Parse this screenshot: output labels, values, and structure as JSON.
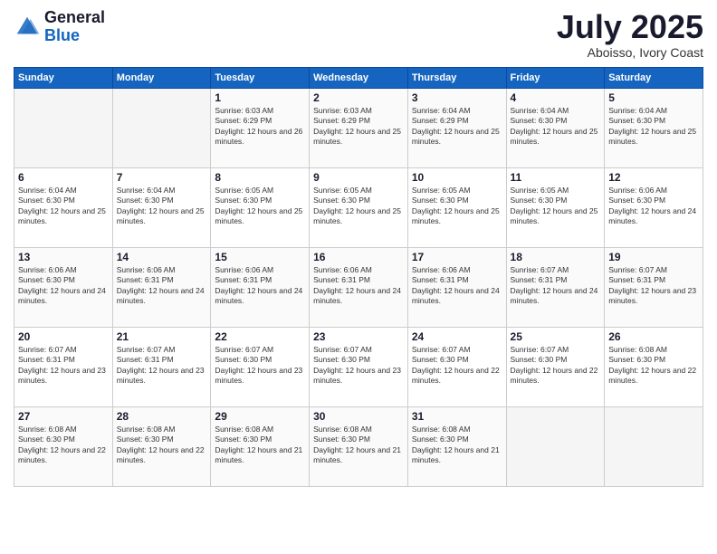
{
  "header": {
    "logo_general": "General",
    "logo_blue": "Blue",
    "month": "July 2025",
    "location": "Aboisso, Ivory Coast"
  },
  "days_of_week": [
    "Sunday",
    "Monday",
    "Tuesday",
    "Wednesday",
    "Thursday",
    "Friday",
    "Saturday"
  ],
  "weeks": [
    [
      {
        "day": "",
        "info": ""
      },
      {
        "day": "",
        "info": ""
      },
      {
        "day": "1",
        "sunrise": "6:03 AM",
        "sunset": "6:29 PM",
        "daylight": "12 hours and 26 minutes."
      },
      {
        "day": "2",
        "sunrise": "6:03 AM",
        "sunset": "6:29 PM",
        "daylight": "12 hours and 25 minutes."
      },
      {
        "day": "3",
        "sunrise": "6:04 AM",
        "sunset": "6:29 PM",
        "daylight": "12 hours and 25 minutes."
      },
      {
        "day": "4",
        "sunrise": "6:04 AM",
        "sunset": "6:30 PM",
        "daylight": "12 hours and 25 minutes."
      },
      {
        "day": "5",
        "sunrise": "6:04 AM",
        "sunset": "6:30 PM",
        "daylight": "12 hours and 25 minutes."
      }
    ],
    [
      {
        "day": "6",
        "sunrise": "6:04 AM",
        "sunset": "6:30 PM",
        "daylight": "12 hours and 25 minutes."
      },
      {
        "day": "7",
        "sunrise": "6:04 AM",
        "sunset": "6:30 PM",
        "daylight": "12 hours and 25 minutes."
      },
      {
        "day": "8",
        "sunrise": "6:05 AM",
        "sunset": "6:30 PM",
        "daylight": "12 hours and 25 minutes."
      },
      {
        "day": "9",
        "sunrise": "6:05 AM",
        "sunset": "6:30 PM",
        "daylight": "12 hours and 25 minutes."
      },
      {
        "day": "10",
        "sunrise": "6:05 AM",
        "sunset": "6:30 PM",
        "daylight": "12 hours and 25 minutes."
      },
      {
        "day": "11",
        "sunrise": "6:05 AM",
        "sunset": "6:30 PM",
        "daylight": "12 hours and 25 minutes."
      },
      {
        "day": "12",
        "sunrise": "6:06 AM",
        "sunset": "6:30 PM",
        "daylight": "12 hours and 24 minutes."
      }
    ],
    [
      {
        "day": "13",
        "sunrise": "6:06 AM",
        "sunset": "6:30 PM",
        "daylight": "12 hours and 24 minutes."
      },
      {
        "day": "14",
        "sunrise": "6:06 AM",
        "sunset": "6:31 PM",
        "daylight": "12 hours and 24 minutes."
      },
      {
        "day": "15",
        "sunrise": "6:06 AM",
        "sunset": "6:31 PM",
        "daylight": "12 hours and 24 minutes."
      },
      {
        "day": "16",
        "sunrise": "6:06 AM",
        "sunset": "6:31 PM",
        "daylight": "12 hours and 24 minutes."
      },
      {
        "day": "17",
        "sunrise": "6:06 AM",
        "sunset": "6:31 PM",
        "daylight": "12 hours and 24 minutes."
      },
      {
        "day": "18",
        "sunrise": "6:07 AM",
        "sunset": "6:31 PM",
        "daylight": "12 hours and 24 minutes."
      },
      {
        "day": "19",
        "sunrise": "6:07 AM",
        "sunset": "6:31 PM",
        "daylight": "12 hours and 23 minutes."
      }
    ],
    [
      {
        "day": "20",
        "sunrise": "6:07 AM",
        "sunset": "6:31 PM",
        "daylight": "12 hours and 23 minutes."
      },
      {
        "day": "21",
        "sunrise": "6:07 AM",
        "sunset": "6:31 PM",
        "daylight": "12 hours and 23 minutes."
      },
      {
        "day": "22",
        "sunrise": "6:07 AM",
        "sunset": "6:30 PM",
        "daylight": "12 hours and 23 minutes."
      },
      {
        "day": "23",
        "sunrise": "6:07 AM",
        "sunset": "6:30 PM",
        "daylight": "12 hours and 23 minutes."
      },
      {
        "day": "24",
        "sunrise": "6:07 AM",
        "sunset": "6:30 PM",
        "daylight": "12 hours and 22 minutes."
      },
      {
        "day": "25",
        "sunrise": "6:07 AM",
        "sunset": "6:30 PM",
        "daylight": "12 hours and 22 minutes."
      },
      {
        "day": "26",
        "sunrise": "6:08 AM",
        "sunset": "6:30 PM",
        "daylight": "12 hours and 22 minutes."
      }
    ],
    [
      {
        "day": "27",
        "sunrise": "6:08 AM",
        "sunset": "6:30 PM",
        "daylight": "12 hours and 22 minutes."
      },
      {
        "day": "28",
        "sunrise": "6:08 AM",
        "sunset": "6:30 PM",
        "daylight": "12 hours and 22 minutes."
      },
      {
        "day": "29",
        "sunrise": "6:08 AM",
        "sunset": "6:30 PM",
        "daylight": "12 hours and 21 minutes."
      },
      {
        "day": "30",
        "sunrise": "6:08 AM",
        "sunset": "6:30 PM",
        "daylight": "12 hours and 21 minutes."
      },
      {
        "day": "31",
        "sunrise": "6:08 AM",
        "sunset": "6:30 PM",
        "daylight": "12 hours and 21 minutes."
      },
      {
        "day": "",
        "info": ""
      },
      {
        "day": "",
        "info": ""
      }
    ]
  ]
}
